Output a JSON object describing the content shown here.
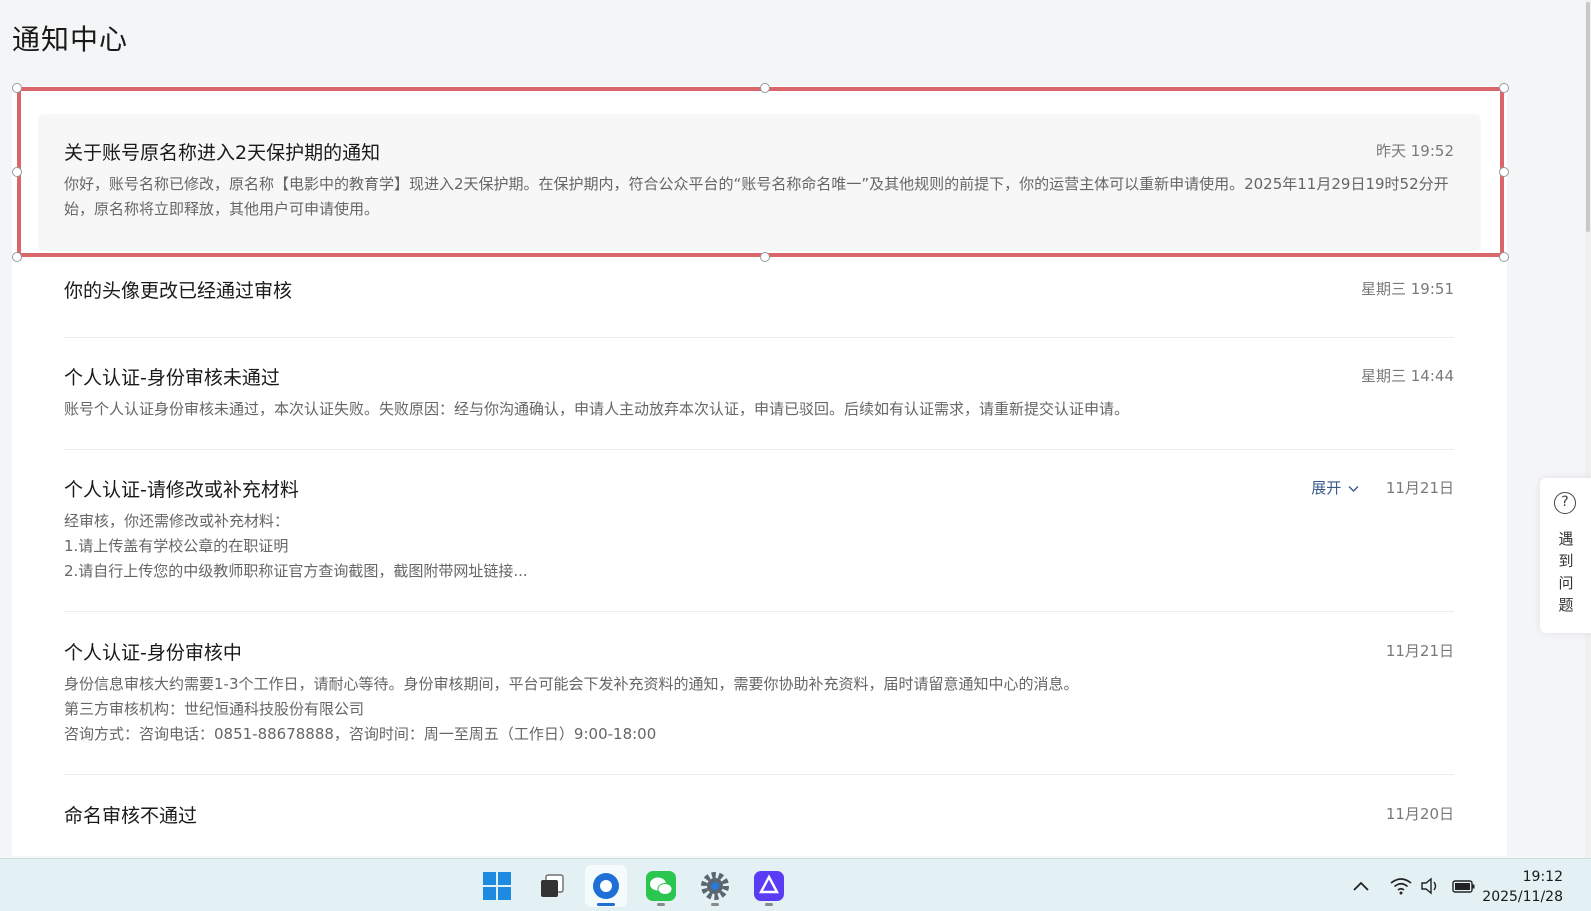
{
  "page": {
    "title": "通知中心"
  },
  "notifications": [
    {
      "title": "关于账号原名称进入2天保护期的通知",
      "time": "昨天 19:52",
      "body": [
        "你好，账号名称已修改，原名称【电影中的教育学】现进入2天保护期。在保护期内，符合公众平台的“账号名称命名唯一”及其他规则的前提下，你的运营主体可以重新申请使用。2025年11月29日19时52分开始，原名称将立即释放，其他用户可申请使用。"
      ]
    },
    {
      "title": "你的头像更改已经通过审核",
      "time": "星期三 19:51",
      "body": []
    },
    {
      "title": "个人认证-身份审核未通过",
      "time": "星期三 14:44",
      "body": [
        "账号个人认证身份审核未通过，本次认证失败。失败原因：经与你沟通确认，申请人主动放弃本次认证，申请已驳回。后续如有认证需求，请重新提交认证申请。"
      ]
    },
    {
      "title": "个人认证-请修改或补充材料",
      "time": "11月21日",
      "expand_label": "展开",
      "body": [
        "经审核，你还需修改或补充材料：",
        "1.请上传盖有学校公章的在职证明",
        "2.请自行上传您的中级教师职称证官方查询截图，截图附带网址链接..."
      ]
    },
    {
      "title": "个人认证-身份审核中",
      "time": "11月21日",
      "body": [
        "身份信息审核大约需要1-3个工作日，请耐心等待。身份审核期间，平台可能会下发补充资料的通知，需要你协助补充资料，届时请留意通知中心的消息。",
        "第三方审核机构：世纪恒通科技股份有限公司",
        "咨询方式：咨询电话：0851-88678888，咨询时间：周一至周五（工作日）9:00-18:00"
      ]
    },
    {
      "title": "命名审核不通过",
      "time": "11月20日",
      "body": []
    }
  ],
  "help": {
    "icon": "question-icon",
    "label": "遇到问题"
  },
  "taskbar": {
    "apps": [
      "windows-start-icon",
      "task-view-icon",
      "browser-icon",
      "wechat-icon",
      "settings-icon",
      "app-icon"
    ],
    "active_index": 2,
    "tray": [
      "chevron-up-icon",
      "wifi-icon",
      "speaker-icon",
      "battery-icon"
    ],
    "clock_time": "19:12",
    "clock_date": "2025/11/28"
  },
  "colors": {
    "accent_red": "#d9666a",
    "link_blue": "#3a5a8c",
    "taskbar_bg": "#e3f0f4"
  }
}
